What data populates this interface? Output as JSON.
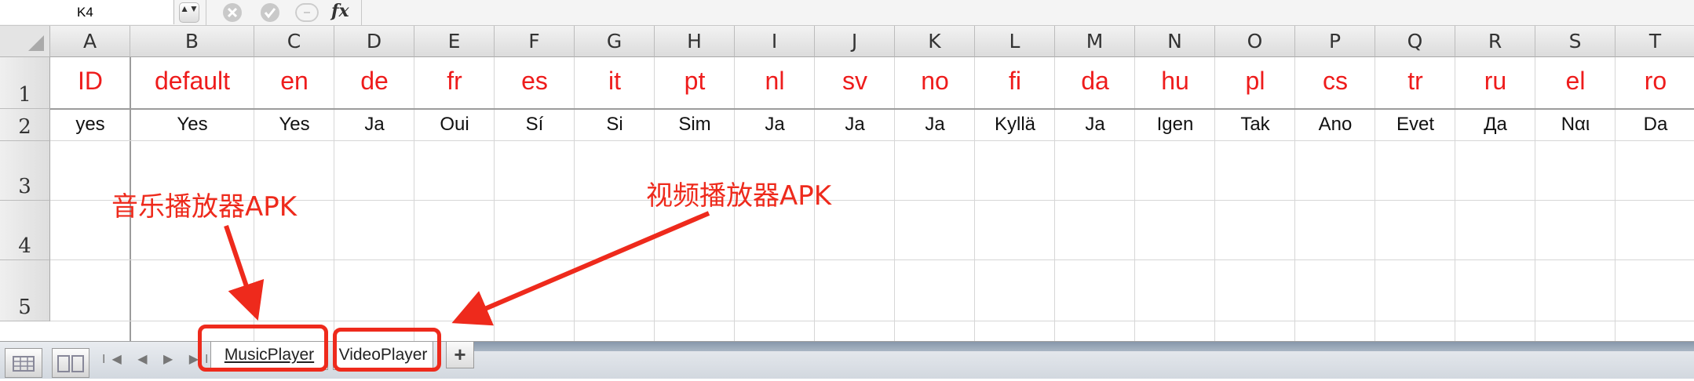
{
  "formula_bar": {
    "name_box": "K4",
    "stepper": "▲▼",
    "fx_label": "fx",
    "cancel_icon": "cancel-icon",
    "confirm_icon": "confirm-icon"
  },
  "columns": [
    "A",
    "B",
    "C",
    "D",
    "E",
    "F",
    "G",
    "H",
    "I",
    "J",
    "K",
    "L",
    "M",
    "N",
    "O",
    "P",
    "Q",
    "R",
    "S",
    "T"
  ],
  "rows": [
    "1",
    "2",
    "3",
    "4",
    "5"
  ],
  "row1": [
    "ID",
    "default",
    "en",
    "de",
    "fr",
    "es",
    "it",
    "pt",
    "nl",
    "sv",
    "no",
    "fi",
    "da",
    "hu",
    "pl",
    "cs",
    "tr",
    "ru",
    "el",
    "ro"
  ],
  "row2": [
    "yes",
    "Yes",
    "Yes",
    "Ja",
    "Oui",
    "Sí",
    "Si",
    "Sim",
    "Ja",
    "Ja",
    "Ja",
    "Kyllä",
    "Ja",
    "Igen",
    "Tak",
    "Ano",
    "Evet",
    "Да",
    "Ναι",
    "Da"
  ],
  "sheet_tabs": {
    "nav": "I◀ ◀ ▶ ▶I",
    "tabs": [
      "MusicPlayer",
      "VideoPlayer"
    ],
    "add": "+"
  },
  "annotations": {
    "music": "音乐播放器APK",
    "video": "视频播放器APK"
  },
  "colors": {
    "annotation": "#ee2a1c",
    "header_text": "#ee1c1c"
  }
}
